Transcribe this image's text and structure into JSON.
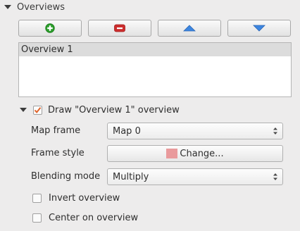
{
  "section": {
    "title": "Overviews"
  },
  "toolbar": {
    "add_icon": "plus-icon",
    "remove_icon": "minus-icon",
    "up_icon": "triangle-up-icon",
    "down_icon": "triangle-down-icon"
  },
  "overview_list": {
    "items": [
      "Overview 1"
    ],
    "selected_index": 0
  },
  "draw_overview": {
    "label": "Draw \"Overview 1\" overview",
    "checked": true
  },
  "form": {
    "map_frame_label": "Map frame",
    "map_frame_value": "Map 0",
    "frame_style_label": "Frame style",
    "frame_style_button": "Change...",
    "frame_style_color": "#e99a9c",
    "blending_mode_label": "Blending mode",
    "blending_mode_value": "Multiply"
  },
  "options": {
    "invert_label": "Invert overview",
    "invert_checked": false,
    "center_label": "Center on overview",
    "center_checked": false
  },
  "colors": {
    "add_green": "#2a9d2a",
    "remove_red": "#cc2d2d",
    "arrow_blue": "#3d86e0",
    "check_orange": "#e0632a"
  }
}
